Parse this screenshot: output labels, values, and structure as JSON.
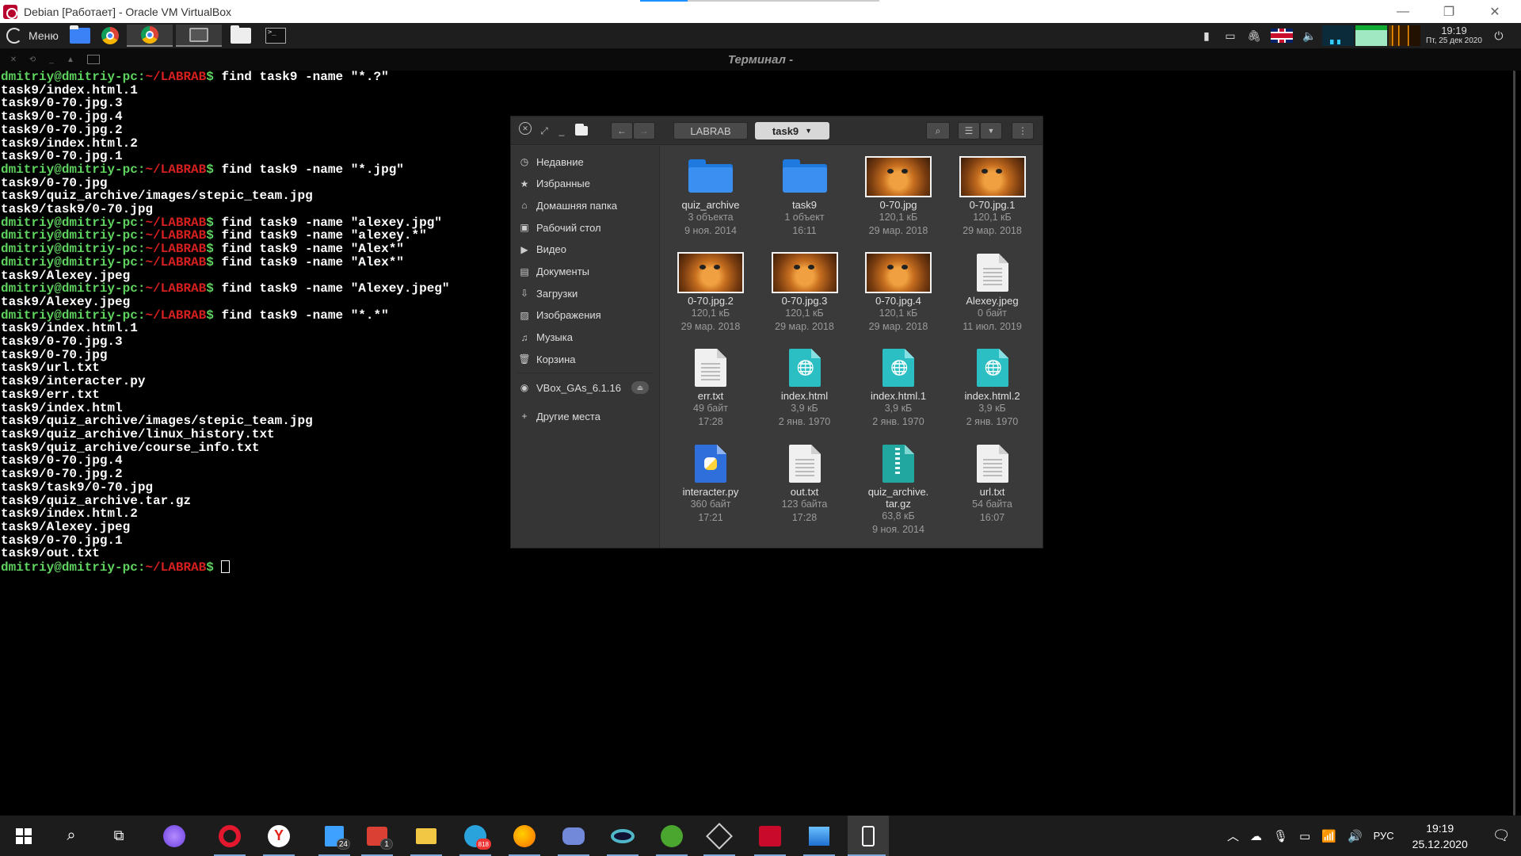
{
  "host_window": {
    "title": "Debian [Работает] - Oracle VM VirtualBox",
    "controls": {
      "minimize": "—",
      "restore": "❐",
      "close": "✕"
    }
  },
  "guest_panel": {
    "menu_label": "Меню",
    "clock_time": "19:19",
    "clock_date": "Пт, 25 дек 2020"
  },
  "terminal": {
    "title": "Терминал -",
    "prompt_user": "dmitriy@dmitriy-pc:",
    "prompt_path": "~/LABRAB",
    "prompt_symbol": "$",
    "lines": [
      {
        "type": "cmd",
        "text": " find task9 -name \"*.?\""
      },
      {
        "type": "out",
        "text": "task9/index.html.1"
      },
      {
        "type": "out",
        "text": "task9/0-70.jpg.3"
      },
      {
        "type": "out",
        "text": "task9/0-70.jpg.4"
      },
      {
        "type": "out",
        "text": "task9/0-70.jpg.2"
      },
      {
        "type": "out",
        "text": "task9/index.html.2"
      },
      {
        "type": "out",
        "text": "task9/0-70.jpg.1"
      },
      {
        "type": "cmd",
        "text": " find task9 -name \"*.jpg\""
      },
      {
        "type": "out",
        "text": "task9/0-70.jpg"
      },
      {
        "type": "out",
        "text": "task9/quiz_archive/images/stepic_team.jpg"
      },
      {
        "type": "out",
        "text": "task9/task9/0-70.jpg"
      },
      {
        "type": "cmd",
        "text": " find task9 -name \"alexey.jpg\""
      },
      {
        "type": "cmd",
        "text": " find task9 -name \"alexey.*\""
      },
      {
        "type": "cmd",
        "text": " find task9 -name \"Alex*\""
      },
      {
        "type": "cmd",
        "text": " find task9 -name \"Alex*\""
      },
      {
        "type": "out",
        "text": "task9/Alexey.jpeg"
      },
      {
        "type": "cmd",
        "text": " find task9 -name \"Alexey.jpeg\""
      },
      {
        "type": "out",
        "text": "task9/Alexey.jpeg"
      },
      {
        "type": "cmd",
        "text": " find task9 -name \"*.*\""
      },
      {
        "type": "out",
        "text": "task9/index.html.1"
      },
      {
        "type": "out",
        "text": "task9/0-70.jpg.3"
      },
      {
        "type": "out",
        "text": "task9/0-70.jpg"
      },
      {
        "type": "out",
        "text": "task9/url.txt"
      },
      {
        "type": "out",
        "text": "task9/interacter.py"
      },
      {
        "type": "out",
        "text": "task9/err.txt"
      },
      {
        "type": "out",
        "text": "task9/index.html"
      },
      {
        "type": "out",
        "text": "task9/quiz_archive/images/stepic_team.jpg"
      },
      {
        "type": "out",
        "text": "task9/quiz_archive/linux_history.txt"
      },
      {
        "type": "out",
        "text": "task9/quiz_archive/course_info.txt"
      },
      {
        "type": "out",
        "text": "task9/0-70.jpg.4"
      },
      {
        "type": "out",
        "text": "task9/0-70.jpg.2"
      },
      {
        "type": "out",
        "text": "task9/task9/0-70.jpg"
      },
      {
        "type": "out",
        "text": "task9/quiz_archive.tar.gz"
      },
      {
        "type": "out",
        "text": "task9/index.html.2"
      },
      {
        "type": "out",
        "text": "task9/Alexey.jpeg"
      },
      {
        "type": "out",
        "text": "task9/0-70.jpg.1"
      },
      {
        "type": "out",
        "text": "task9/out.txt"
      },
      {
        "type": "cmd",
        "text": " "
      }
    ]
  },
  "file_manager": {
    "breadcrumbs": [
      "LABRAB",
      "task9"
    ],
    "sidebar": [
      {
        "label": "Недавние",
        "icon": "clock-icon"
      },
      {
        "label": "Избранные",
        "icon": "star-icon"
      },
      {
        "label": "Домашняя папка",
        "icon": "home-icon"
      },
      {
        "label": "Рабочий стол",
        "icon": "desktop-icon"
      },
      {
        "label": "Видео",
        "icon": "video-icon"
      },
      {
        "label": "Документы",
        "icon": "document-icon"
      },
      {
        "label": "Загрузки",
        "icon": "download-icon"
      },
      {
        "label": "Изображения",
        "icon": "image-icon"
      },
      {
        "label": "Музыка",
        "icon": "music-icon"
      },
      {
        "label": "Корзина",
        "icon": "trash-icon"
      },
      {
        "label": "VBox_GAs_6.1.16",
        "icon": "disc-icon"
      },
      {
        "label": "Другие места",
        "icon": "plus-icon"
      }
    ],
    "files": [
      {
        "name": "quiz_archive",
        "size": "3 объекта",
        "date": "9 ноя. 2014",
        "kind": "folder"
      },
      {
        "name": "task9",
        "size": "1 объект",
        "date": "16:11",
        "kind": "folder"
      },
      {
        "name": "0-70.jpg",
        "size": "120,1 кБ",
        "date": "29 мар. 2018",
        "kind": "image"
      },
      {
        "name": "0-70.jpg.1",
        "size": "120,1 кБ",
        "date": "29 мар. 2018",
        "kind": "image"
      },
      {
        "name": "0-70.jpg.2",
        "size": "120,1 кБ",
        "date": "29 мар. 2018",
        "kind": "image"
      },
      {
        "name": "0-70.jpg.3",
        "size": "120,1 кБ",
        "date": "29 мар. 2018",
        "kind": "image"
      },
      {
        "name": "0-70.jpg.4",
        "size": "120,1 кБ",
        "date": "29 мар. 2018",
        "kind": "image"
      },
      {
        "name": "Alexey.jpeg",
        "size": "0 байт",
        "date": "11 июл. 2019",
        "kind": "doc"
      },
      {
        "name": "err.txt",
        "size": "49 байт",
        "date": "17:28",
        "kind": "doc"
      },
      {
        "name": "index.html",
        "size": "3,9 кБ",
        "date": "2 янв. 1970",
        "kind": "html"
      },
      {
        "name": "index.html.1",
        "size": "3,9 кБ",
        "date": "2 янв. 1970",
        "kind": "html"
      },
      {
        "name": "index.html.2",
        "size": "3,9 кБ",
        "date": "2 янв. 1970",
        "kind": "html"
      },
      {
        "name": "interacter.py",
        "size": "360 байт",
        "date": "17:21",
        "kind": "py"
      },
      {
        "name": "out.txt",
        "size": "123 байта",
        "date": "17:28",
        "kind": "doc"
      },
      {
        "name": "quiz_archive.\ntar.gz",
        "size": "63,8 кБ",
        "date": "9 ноя. 2014",
        "kind": "zip"
      },
      {
        "name": "url.txt",
        "size": "54 байта",
        "date": "16:07",
        "kind": "doc"
      }
    ]
  },
  "win_taskbar": {
    "badges": {
      "files": "24",
      "todoist": "1",
      "telegram": "818"
    },
    "language": "РУС",
    "time": "19:19",
    "date": "25.12.2020"
  }
}
